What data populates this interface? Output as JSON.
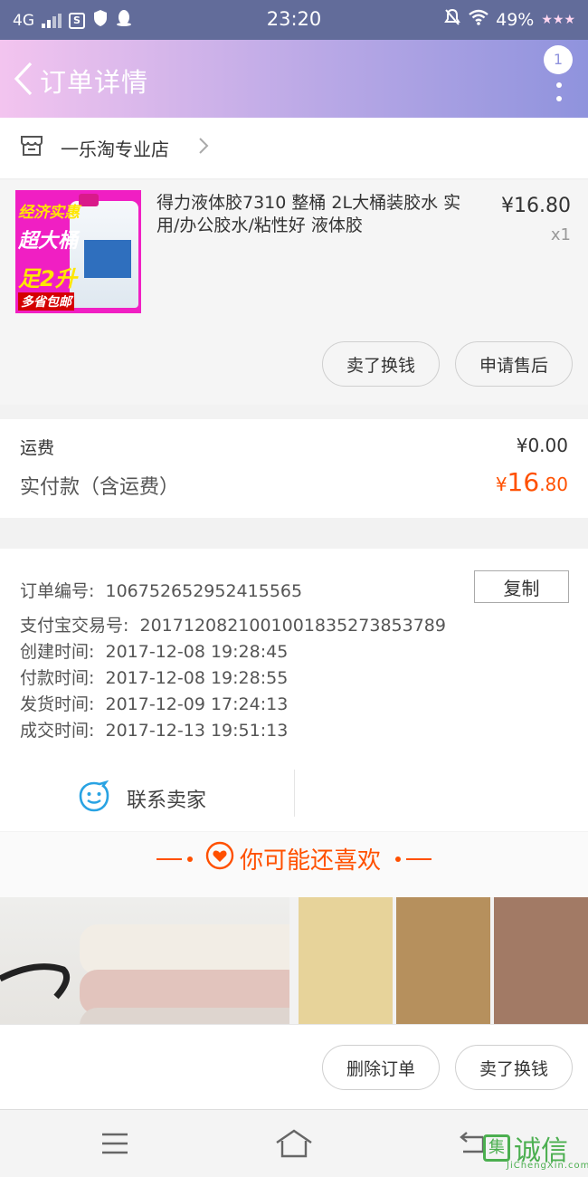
{
  "status_bar": {
    "network": "4G",
    "time": "23:20",
    "battery": "49%"
  },
  "header": {
    "title": "订单详情",
    "badge_count": "1"
  },
  "shop": {
    "name": "一乐淘专业店"
  },
  "product": {
    "image_texts": [
      "经济实惠",
      "超大桶",
      "足2升",
      "多省包邮"
    ],
    "title": "得力液体胶7310 整桶 2L大桶装胶水 实用/办公胶水/粘性好 液体胶",
    "price": "¥16.80",
    "quantity": "x1",
    "actions": [
      "卖了换钱",
      "申请售后"
    ]
  },
  "fees": {
    "shipping_label": "运费",
    "shipping_value": "¥0.00",
    "total_label": "实付款（含运费）",
    "total_currency": "¥",
    "total_int": "16",
    "total_dec": ".80"
  },
  "order_info": {
    "copy_label": "复制",
    "rows": [
      {
        "label": "订单编号:",
        "value": "106752652952415565"
      },
      {
        "label": "支付宝交易号:",
        "value": "2017120821001001835273853789"
      },
      {
        "label": "创建时间:",
        "value": "2017-12-08 19:28:45"
      },
      {
        "label": "付款时间:",
        "value": "2017-12-08 19:28:55"
      },
      {
        "label": "发货时间:",
        "value": "2017-12-09 17:24:13"
      },
      {
        "label": "成交时间:",
        "value": "2017-12-13 19:51:13"
      }
    ],
    "contact_label": "联系卖家"
  },
  "recommend": {
    "title": "你可能还喜欢"
  },
  "bottom_actions": [
    "删除订单",
    "卖了换钱"
  ],
  "watermark": {
    "logo": "集",
    "text": "诚信",
    "sub": "JiChengXin.com"
  },
  "colors": {
    "accent": "#ff5000",
    "status_bar": "#626c9a",
    "header_start": "#f3c4ef",
    "header_end": "#8f93dd"
  }
}
